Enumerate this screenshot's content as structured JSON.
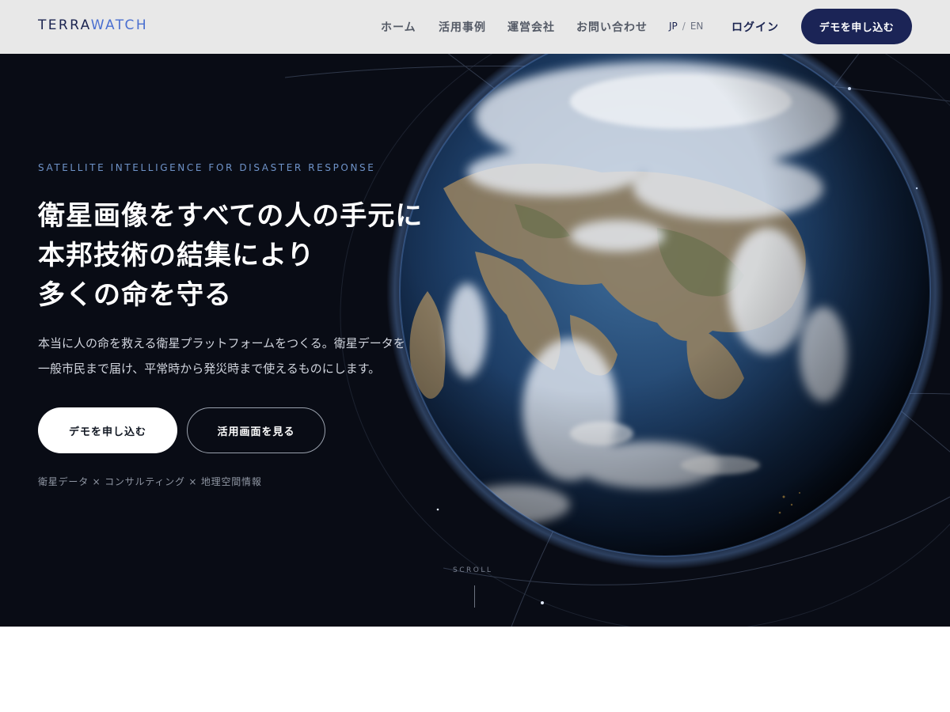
{
  "header": {
    "logo_part1": "TERRA",
    "logo_part2": "WATCH",
    "nav": [
      {
        "label": "ホーム"
      },
      {
        "label": "活用事例"
      },
      {
        "label": "運営会社"
      },
      {
        "label": "お問い合わせ"
      }
    ],
    "lang_jp": "JP",
    "lang_sep": "/",
    "lang_en": "EN",
    "login": "ログイン",
    "demo_button": "デモを申し込む"
  },
  "hero": {
    "eyebrow": "SATELLITE INTELLIGENCE FOR DISASTER RESPONSE",
    "headline": [
      "衛星画像をすべての人の手元に",
      "本邦技術の結集により",
      "多くの命を守る"
    ],
    "description": [
      "本当に人の命を救える衛星プラットフォームをつくる。衛星データを",
      "一般市民まで届け、平常時から発災時まで使えるものにします。"
    ],
    "primary_button": "デモを申し込む",
    "secondary_button": "活用画面を見る",
    "tags": "衛星データ × コンサルティング × 地理空間情報",
    "scroll": "SCROLL"
  },
  "colors": {
    "navy": "#1b2456",
    "hero_bg": "#090c15",
    "eyebrow": "#6f93c9"
  },
  "icons": {
    "globe": "earth-globe-image"
  }
}
